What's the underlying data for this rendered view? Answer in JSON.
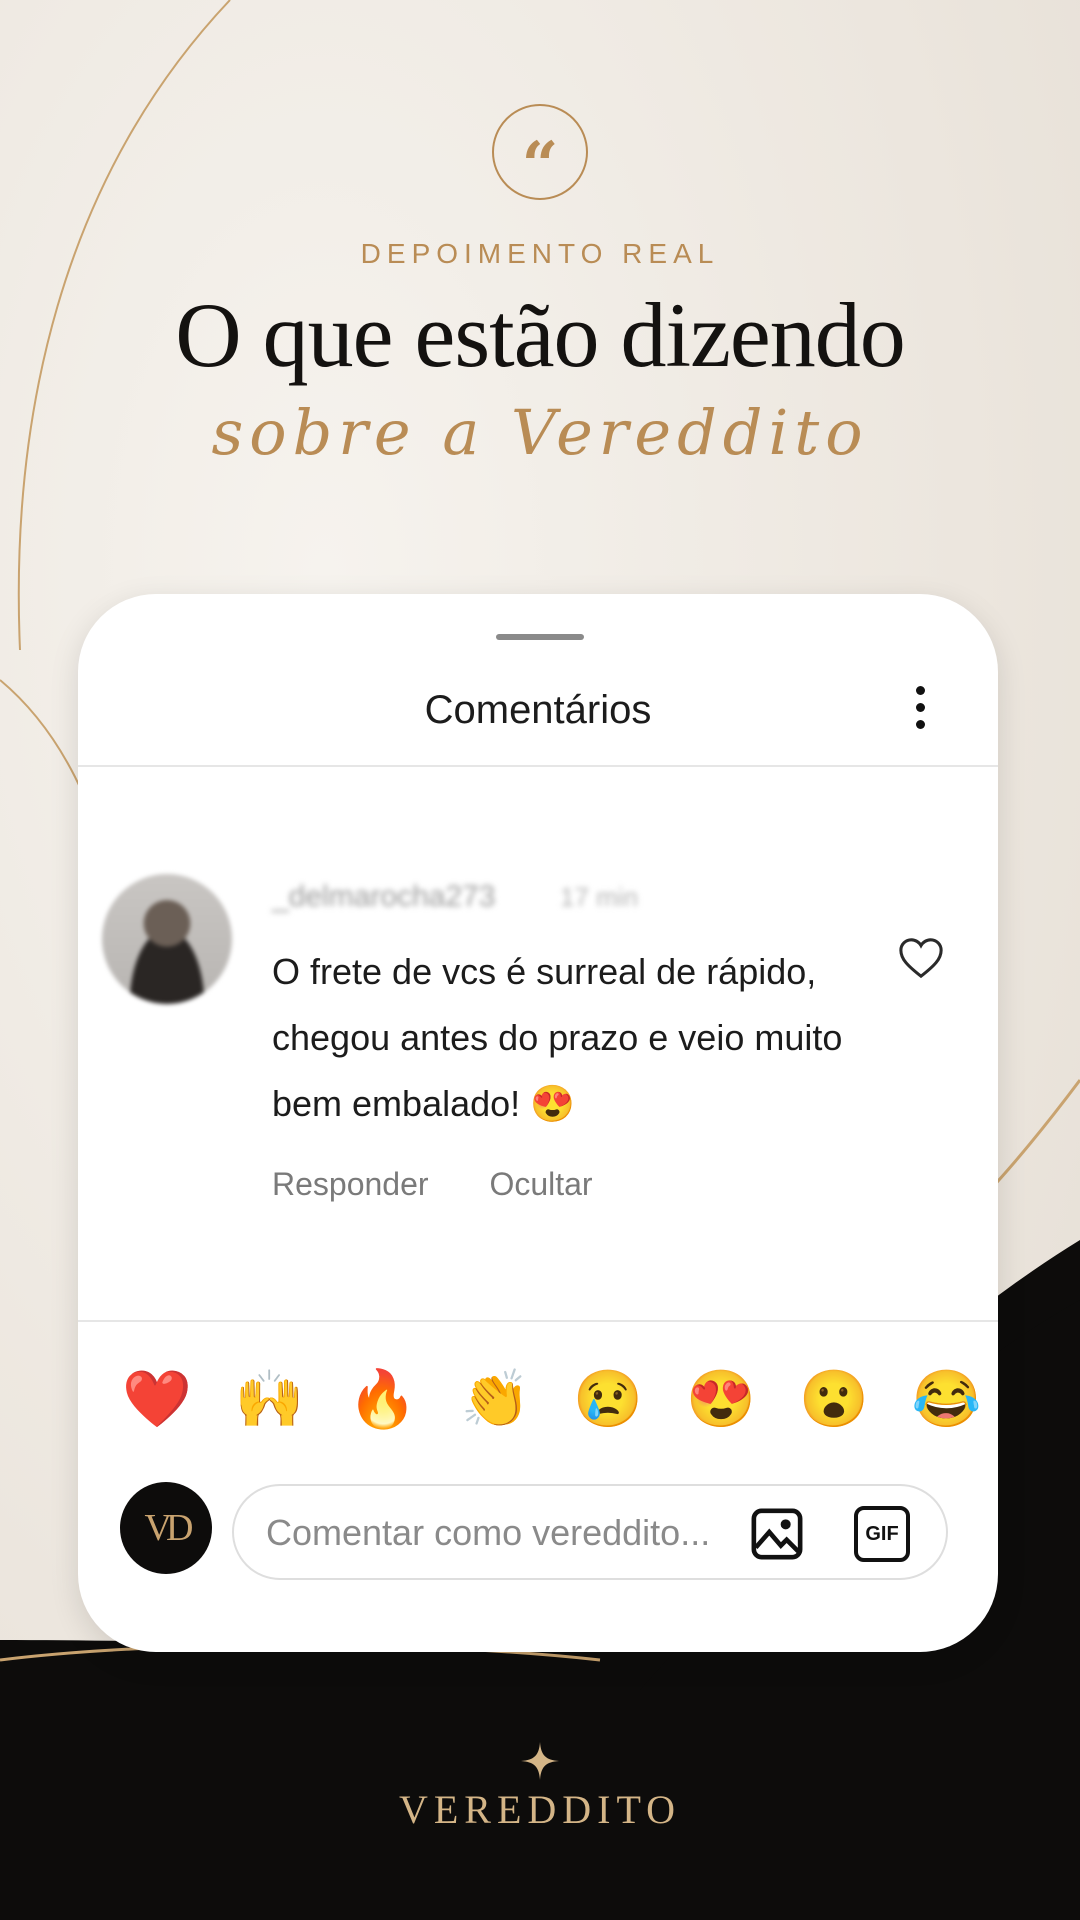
{
  "header": {
    "quote_glyph": "“",
    "kicker": "DEPOIMENTO REAL",
    "headline": "O que estão dizendo",
    "script_line": "sobre a Vereddito"
  },
  "card": {
    "title": "Comentários",
    "comment": {
      "username": "_delmarocha273",
      "time": "17 min",
      "text": "O frete de vcs é surreal de rápido, chegou antes do prazo e veio muito bem embalado! 😍",
      "actions": [
        "Responder",
        "Ocultar"
      ]
    },
    "reactions": [
      "❤️",
      "🙌",
      "🔥",
      "👏",
      "😢",
      "😍",
      "😮",
      "😂"
    ],
    "composer": {
      "avatar_text": "VD",
      "placeholder": "Comentar como vereddito...",
      "gif_label": "GIF"
    }
  },
  "footer": {
    "brand": "VEREDDITO"
  },
  "colors": {
    "gold": "#b98c55",
    "dark": "#0d0c0b",
    "background": "#ece6de"
  },
  "icons": [
    "quote-icon",
    "more-vertical-icon",
    "heart-outline-icon",
    "image-icon",
    "gif-icon",
    "sparkle-icon"
  ]
}
